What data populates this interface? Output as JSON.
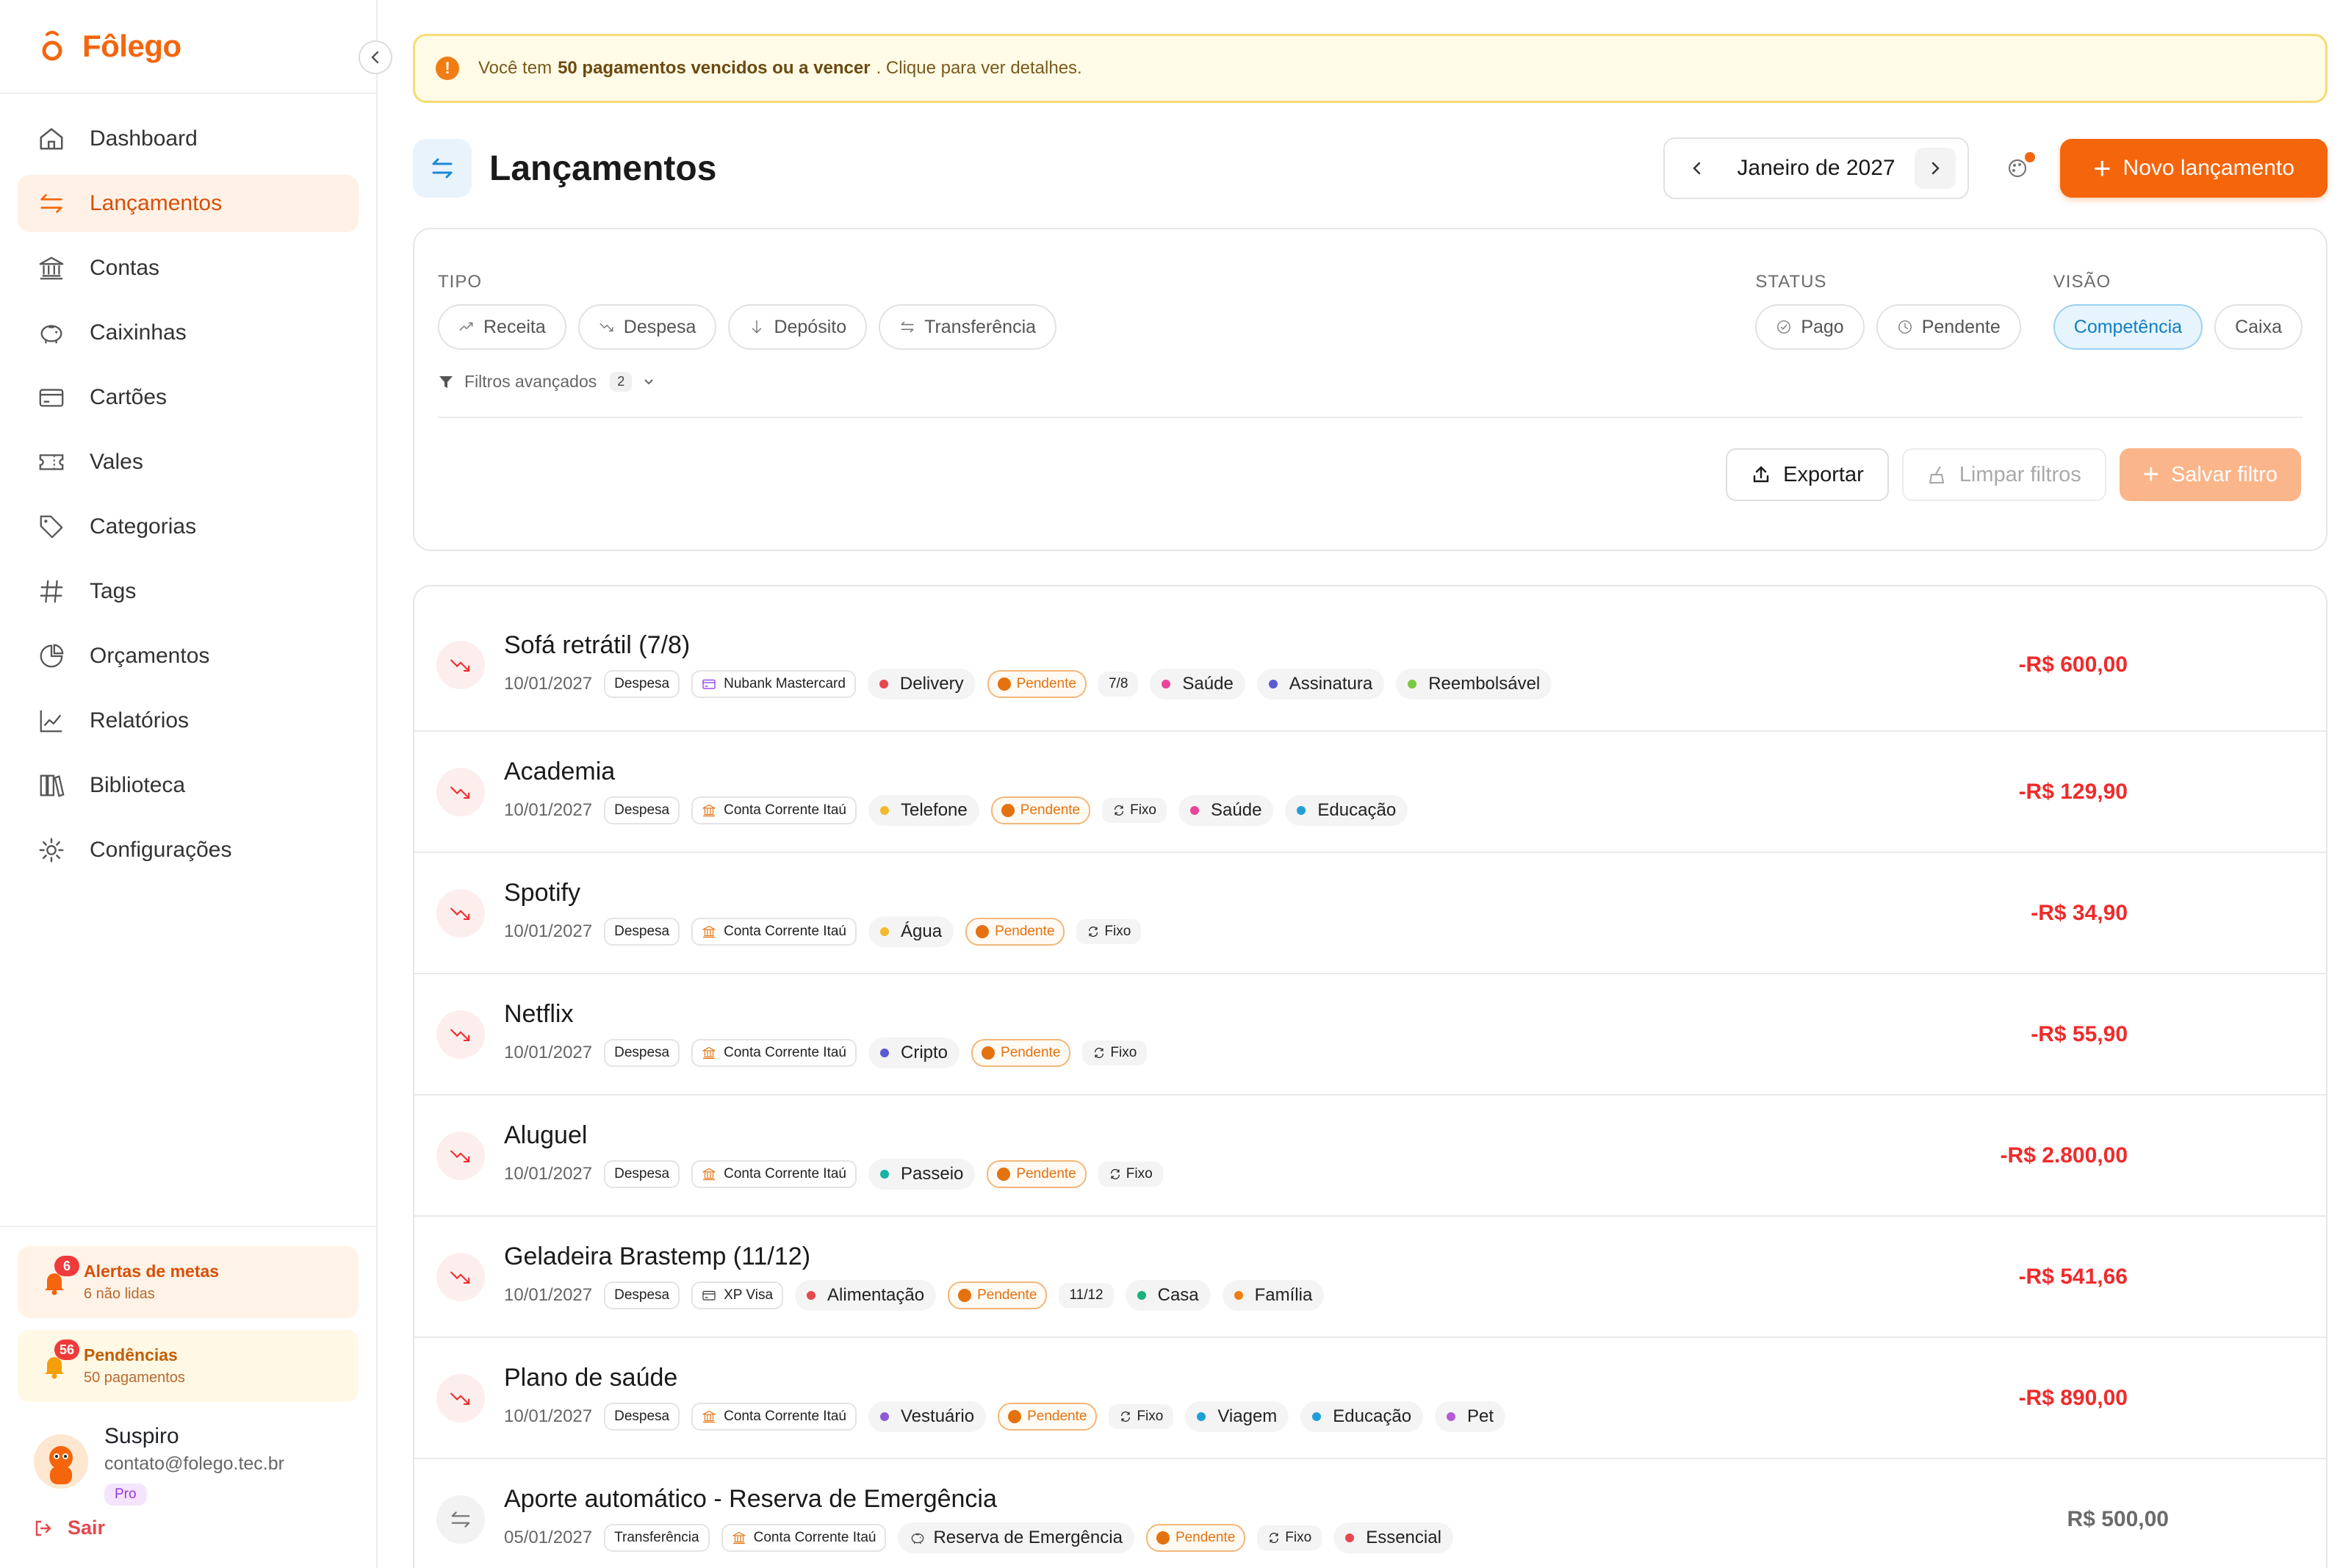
{
  "app": {
    "name": "Fôlego"
  },
  "sidebar": {
    "items": [
      {
        "label": "Dashboard",
        "icon": "home-icon"
      },
      {
        "label": "Lançamentos",
        "icon": "arrows-left-right-icon",
        "active": true
      },
      {
        "label": "Contas",
        "icon": "bank-icon"
      },
      {
        "label": "Caixinhas",
        "icon": "piggy-bank-icon"
      },
      {
        "label": "Cartões",
        "icon": "credit-card-icon"
      },
      {
        "label": "Vales",
        "icon": "ticket-icon"
      },
      {
        "label": "Categorias",
        "icon": "tag-icon"
      },
      {
        "label": "Tags",
        "icon": "hash-icon"
      },
      {
        "label": "Orçamentos",
        "icon": "pie-chart-icon"
      },
      {
        "label": "Relatórios",
        "icon": "line-chart-icon"
      },
      {
        "label": "Biblioteca",
        "icon": "library-icon"
      },
      {
        "label": "Configurações",
        "icon": "gear-icon"
      }
    ],
    "alerts": {
      "title": "Alertas de metas",
      "subtitle": "6 não lidas",
      "count": "6"
    },
    "pending": {
      "title": "Pendências",
      "subtitle": "50 pagamentos",
      "count": "56"
    },
    "user": {
      "name": "Suspiro",
      "email": "contato@folego.tec.br",
      "plan": "Pro"
    },
    "logout": "Sair"
  },
  "banner": {
    "prefix": "Você tem",
    "highlight": "50 pagamentos vencidos ou a vencer",
    "suffix": ". Clique para ver detalhes."
  },
  "header": {
    "title": "Lançamentos",
    "month": "Janeiro de 2027",
    "new_button": "Novo lançamento"
  },
  "filters": {
    "tipo_label": "TIPO",
    "tipo": [
      "Receita",
      "Despesa",
      "Depósito",
      "Transferência"
    ],
    "status_label": "STATUS",
    "status": [
      "Pago",
      "Pendente"
    ],
    "visao_label": "VISÃO",
    "visao": [
      "Competência",
      "Caixa"
    ],
    "visao_selected": "Competência",
    "advanced_label": "Filtros avançados",
    "advanced_count": "2",
    "export": "Exportar",
    "clear": "Limpar filtros",
    "save": "Salvar filtro"
  },
  "colors": {
    "brand": "#f5650b",
    "expense": "#ef2b2b",
    "pending": "#e4720e",
    "selected_blue": "#127ec2"
  },
  "transactions": [
    {
      "title": "Sofá retrátil (7/8)",
      "date": "10/01/2027",
      "type": "Despesa",
      "account": {
        "label": "Nubank Mastercard",
        "icon": "credit-card-icon"
      },
      "category": {
        "label": "Delivery",
        "color": "#e5484d"
      },
      "status": "Pendente",
      "extra": "7/8",
      "tags": [
        {
          "label": "Saúde",
          "color": "#e8459a"
        },
        {
          "label": "Assinatura",
          "color": "#5b5bd6"
        },
        {
          "label": "Reembolsável",
          "color": "#7ac943"
        }
      ],
      "amount": "-R$ 600,00",
      "kind": "expense"
    },
    {
      "title": "Academia",
      "date": "10/01/2027",
      "type": "Despesa",
      "account": {
        "label": "Conta Corrente Itaú",
        "icon": "bank-icon"
      },
      "category": {
        "label": "Telefone",
        "color": "#f5b82e"
      },
      "status": "Pendente",
      "extra": "Fixo",
      "tags": [
        {
          "label": "Saúde",
          "color": "#e8459a"
        },
        {
          "label": "Educação",
          "color": "#1ea0d6"
        }
      ],
      "amount": "-R$ 129,90",
      "kind": "expense"
    },
    {
      "title": "Spotify",
      "date": "10/01/2027",
      "type": "Despesa",
      "account": {
        "label": "Conta Corrente Itaú",
        "icon": "bank-icon"
      },
      "category": {
        "label": "Água",
        "color": "#f5b82e"
      },
      "status": "Pendente",
      "extra": "Fixo",
      "tags": [],
      "amount": "-R$ 34,90",
      "kind": "expense"
    },
    {
      "title": "Netflix",
      "date": "10/01/2027",
      "type": "Despesa",
      "account": {
        "label": "Conta Corrente Itaú",
        "icon": "bank-icon"
      },
      "category": {
        "label": "Cripto",
        "color": "#5b5bd6"
      },
      "status": "Pendente",
      "extra": "Fixo",
      "tags": [],
      "amount": "-R$ 55,90",
      "kind": "expense"
    },
    {
      "title": "Aluguel",
      "date": "10/01/2027",
      "type": "Despesa",
      "account": {
        "label": "Conta Corrente Itaú",
        "icon": "bank-icon"
      },
      "category": {
        "label": "Passeio",
        "color": "#17b3a3"
      },
      "status": "Pendente",
      "extra": "Fixo",
      "tags": [],
      "amount": "-R$ 2.800,00",
      "kind": "expense"
    },
    {
      "title": "Geladeira Brastemp (11/12)",
      "date": "10/01/2027",
      "type": "Despesa",
      "account": {
        "label": "XP Visa",
        "icon": "credit-card-icon"
      },
      "category": {
        "label": "Alimentação",
        "color": "#e5484d"
      },
      "status": "Pendente",
      "extra": "11/12",
      "tags": [
        {
          "label": "Casa",
          "color": "#17b37a"
        },
        {
          "label": "Família",
          "color": "#f07d13"
        }
      ],
      "amount": "-R$ 541,66",
      "kind": "expense"
    },
    {
      "title": "Plano de saúde",
      "date": "10/01/2027",
      "type": "Despesa",
      "account": {
        "label": "Conta Corrente Itaú",
        "icon": "bank-icon"
      },
      "category": {
        "label": "Vestuário",
        "color": "#8e5bd6"
      },
      "status": "Pendente",
      "extra": "Fixo",
      "tags": [
        {
          "label": "Viagem",
          "color": "#1ea0d6"
        },
        {
          "label": "Educação",
          "color": "#1ea0d6"
        },
        {
          "label": "Pet",
          "color": "#b45bd6"
        }
      ],
      "amount": "-R$ 890,00",
      "kind": "expense"
    },
    {
      "title": "Aporte automático - Reserva de Emergência",
      "date": "05/01/2027",
      "type": "Transferência",
      "account": {
        "label": "Conta Corrente Itaú",
        "icon": "bank-icon"
      },
      "category": {
        "label": "Reserva de Emergência",
        "color": "",
        "icon": "piggy-bank-icon"
      },
      "status": "Pendente",
      "extra": "Fixo",
      "tags": [
        {
          "label": "Essencial",
          "color": "#e5484d"
        }
      ],
      "amount": "R$ 500,00",
      "kind": "transfer"
    }
  ]
}
